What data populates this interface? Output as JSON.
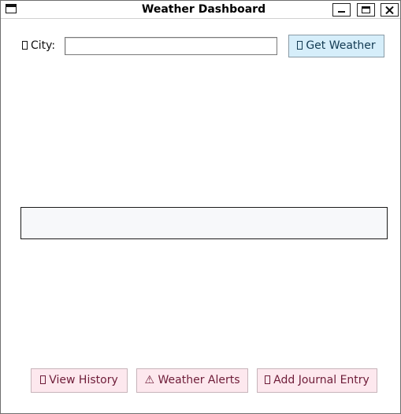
{
  "window": {
    "title": "Weather Dashboard"
  },
  "search": {
    "city_label": "City:",
    "city_value": "",
    "city_placeholder": "",
    "get_weather_label": "Get Weather"
  },
  "result": {
    "text": ""
  },
  "actions": {
    "history_label": "View History",
    "alerts_icon": "⚠",
    "alerts_label": "Weather Alerts",
    "journal_label": "Add Journal Entry"
  },
  "icons": {
    "city": "missing-glyph-icon",
    "get_weather": "missing-glyph-icon",
    "history": "missing-glyph-icon",
    "alerts": "warning-icon",
    "journal": "missing-glyph-icon"
  },
  "colors": {
    "get_weather_bg": "#d6eefa",
    "action_bg": "#fde8ee",
    "action_text": "#6e1c38",
    "result_bg": "#f7f8fa"
  }
}
